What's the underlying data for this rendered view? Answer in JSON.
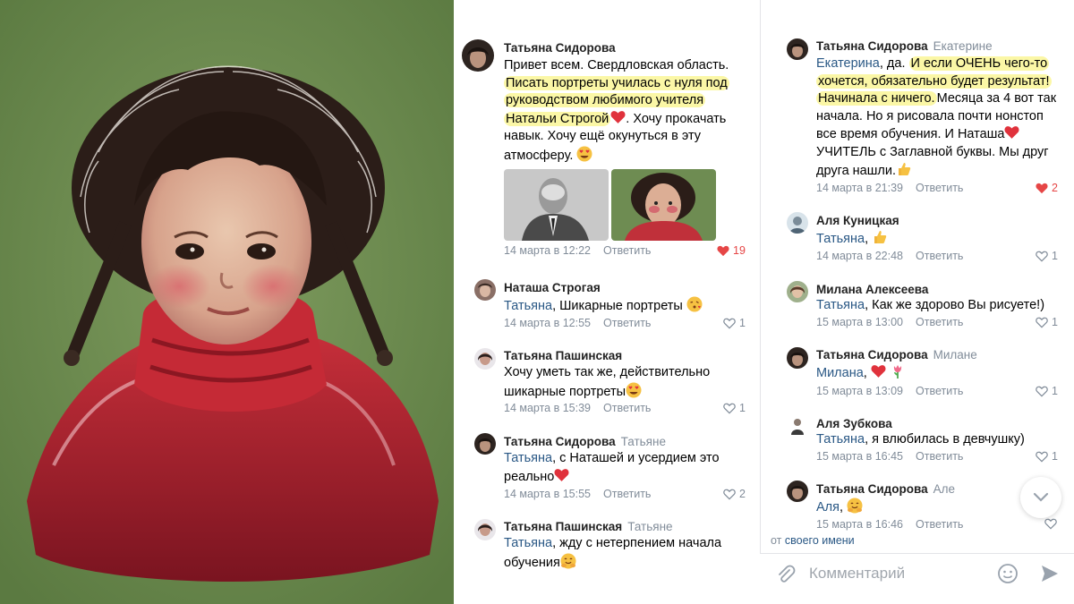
{
  "left_column": [
    {
      "author": "Татьяна Сидорова",
      "reply_to": "",
      "text_plain": "Привет всем. Свердловская область.",
      "text_highlight_1": "Писать портреты училась с нуля под",
      "text_highlight_2": "руководством любимого учителя",
      "text_highlight_3": "Натальи Строгой",
      "text_after_1": ". Хочу прокачать",
      "text_after_2": "навык. Хочу ещё окунуться в эту",
      "text_after_3": "атмосферу.",
      "date": "14 марта в 12:22",
      "reply_label": "Ответить",
      "likes": "19"
    },
    {
      "author": "Наташа Строгая",
      "mention": "Татьяна",
      "text": ", Шикарные портреты",
      "date": "14 марта в 12:55",
      "reply_label": "Ответить",
      "likes": "1"
    },
    {
      "author": "Татьяна Пашинская",
      "text_1": "Хочу уметь так же, действительно",
      "text_2": "шикарные портреты",
      "date": "14 марта в 15:39",
      "reply_label": "Ответить",
      "likes": "1"
    },
    {
      "author": "Татьяна Сидорова",
      "reply_to": "Татьяне",
      "mention": "Татьяна",
      "text_1": ", с Наташей и усердием это",
      "text_2": "реально",
      "date": "14 марта в 15:55",
      "reply_label": "Ответить",
      "likes": "2"
    },
    {
      "author": "Татьяна Пашинская",
      "reply_to": "Татьяне",
      "mention": "Татьяна",
      "text_1": ", жду с нетерпением начала",
      "text_2": "обучения"
    }
  ],
  "right_column": [
    {
      "author": "Татьяна Сидорова",
      "reply_to": "Екатерине",
      "mention": "Екатерина",
      "text_a": ", да.",
      "text_hl_1": "И если ОЧЕНЬ чего-то",
      "text_hl_2": "хочется, обязательно будет результат!",
      "text_hl_3": "Начинала с ничего.",
      "text_b": "Месяца за 4 вот так",
      "text_c": "начала. Но я рисовала почти нонстоп",
      "text_d": "все  время обучения. И Наташа",
      "text_e": "УЧИТЕЛЬ с Заглавной буквы. Мы друг",
      "text_f": "друга нашли.",
      "date": "14 марта в 21:39",
      "reply_label": "Ответить",
      "likes": "2"
    },
    {
      "author": "Аля Куницкая",
      "mention": "Татьяна",
      "text": ",",
      "date": "14 марта в 22:48",
      "reply_label": "Ответить",
      "likes": "1"
    },
    {
      "author": "Милана Алексеева",
      "mention": "Татьяна",
      "text": ", Как же здорово Вы рисуете!)",
      "date": "15 марта в 13:00",
      "reply_label": "Ответить",
      "likes": "1"
    },
    {
      "author": "Татьяна Сидорова",
      "reply_to": "Милане",
      "mention": "Милана",
      "text": ",",
      "date": "15 марта в 13:09",
      "reply_label": "Ответить",
      "likes": "1"
    },
    {
      "author": "Аля Зубкова",
      "mention": "Татьяна",
      "text": ", я влюбилась в девчушку)",
      "date": "15 марта в 16:45",
      "reply_label": "Ответить",
      "likes": "1"
    },
    {
      "author": "Татьяна Сидорова",
      "reply_to": "Але",
      "mention": "Аля",
      "text": ",",
      "date": "15 марта в 16:46",
      "reply_label": "Ответить"
    }
  ],
  "composer": {
    "from_prefix": "от",
    "from_own": "своего имени",
    "placeholder": "Комментарий"
  },
  "colors": {
    "link": "#2a5885",
    "meta": "#818c99",
    "highlight": "#fbf7a6",
    "like_red": "#e64646",
    "painting_bg": "#6b8a4f"
  },
  "icons": [
    "heart-icon",
    "chevron-down-icon",
    "attach-icon",
    "emoji-icon",
    "send-icon"
  ]
}
